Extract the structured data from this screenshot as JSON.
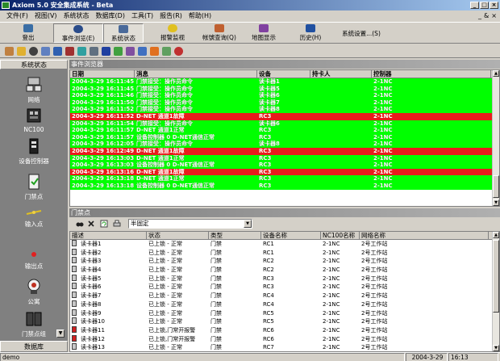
{
  "window": {
    "title": "Axiom 5.0 安全集成系统 - Beta"
  },
  "menu": [
    "文件(F)",
    "视图(V)",
    "系统状态",
    "数据库(D)",
    "工具(T)",
    "报告(R)",
    "帮助(H)"
  ],
  "menu_right": [
    "_",
    "&",
    "×"
  ],
  "toolbar": {
    "buttons": [
      {
        "label": "登出",
        "color": "#3a6ea5"
      },
      {
        "label": "事件浏览(E)",
        "color": "#2a4c8a"
      },
      {
        "label": "系统状态",
        "color": "#4a6a9a"
      },
      {
        "label": "报警监视",
        "color": "#e0c020"
      },
      {
        "label": "帐號查询(Q)",
        "color": "#c06030"
      },
      {
        "label": "地图显示",
        "color": "#8040a0"
      },
      {
        "label": "历史(H)",
        "color": "#2050a0"
      },
      {
        "label": "系统设置...(S)",
        "color": "#d4d0c8"
      }
    ]
  },
  "sidebar": {
    "title": "系统状态",
    "items": [
      {
        "label": "网络",
        "icon": "network-icon"
      },
      {
        "label": "NC100",
        "icon": "controller-icon"
      },
      {
        "label": "设备控制器",
        "icon": "device-controller-icon"
      },
      {
        "label": "门禁点",
        "icon": "door-point-icon"
      },
      {
        "label": "输入点",
        "icon": "input-point-icon"
      },
      {
        "label": "输出点",
        "icon": "output-point-icon"
      },
      {
        "label": "公寓",
        "icon": "apartment-icon"
      },
      {
        "label": "门禁点组",
        "icon": "door-group-icon"
      }
    ],
    "footer": "数据库"
  },
  "event_viewer": {
    "title": "事件浏览器",
    "columns": [
      "日期",
      "消息",
      "设备",
      "持卡人",
      "控制器"
    ],
    "rows": [
      {
        "date": "2004-3-29 16:11:45",
        "message": "门禁接受：操作员命令",
        "device": "读卡器1",
        "holder": "",
        "controller": "2-1NC",
        "status": "ok"
      },
      {
        "date": "2004-3-29 16:11:45",
        "message": "门禁接受：操作员命令",
        "device": "读卡器5",
        "holder": "",
        "controller": "2-1NC",
        "status": "ok"
      },
      {
        "date": "2004-3-29 16:11:46",
        "message": "门禁接受：操作员命令",
        "device": "读卡器6",
        "holder": "",
        "controller": "2-1NC",
        "status": "ok"
      },
      {
        "date": "2004-3-29 16:11:50",
        "message": "门禁接受：操作员命令",
        "device": "读卡器7",
        "holder": "",
        "controller": "2-1NC",
        "status": "ok"
      },
      {
        "date": "2004-3-29 16:11:52",
        "message": "门禁接受：操作员命令",
        "device": "读卡器8",
        "holder": "",
        "controller": "2-1NC",
        "status": "ok"
      },
      {
        "date": "2004-3-29 16:11:52",
        "message": "D-NET 通道1故障",
        "device": "RC3",
        "holder": "",
        "controller": "2-1NC",
        "status": "alarm"
      },
      {
        "date": "2004-3-29 16:11:54",
        "message": "门禁接受：操作员命令",
        "device": "读卡器6",
        "holder": "",
        "controller": "2-1NC",
        "status": "ok"
      },
      {
        "date": "2004-3-29 16:11:57",
        "message": "D-NET 通道1正常",
        "device": "RC3",
        "holder": "",
        "controller": "2-1NC",
        "status": "ok"
      },
      {
        "date": "2004-3-29 16:11:57",
        "message": "设备控制器 0 D-NET通信正常",
        "device": "RC3",
        "holder": "",
        "controller": "2-1NC",
        "status": "ok"
      },
      {
        "date": "2004-3-29 16:12:05",
        "message": "门禁接受：操作员命令",
        "device": "读卡器8",
        "holder": "",
        "controller": "2-1NC",
        "status": "ok"
      },
      {
        "date": "2004-3-29 16:12:49",
        "message": "D-NET 通道1故障",
        "device": "RC3",
        "holder": "",
        "controller": "2-1NC",
        "status": "alarm"
      },
      {
        "date": "2004-3-29 16:13:03",
        "message": "D-NET 通道1正常",
        "device": "RC3",
        "holder": "",
        "controller": "2-1NC",
        "status": "ok"
      },
      {
        "date": "2004-3-29 16:13:03",
        "message": "设备控制器 0 D-NET通信正常",
        "device": "RC3",
        "holder": "",
        "controller": "2-1NC",
        "status": "ok"
      },
      {
        "date": "2004-3-29 16:13:16",
        "message": "D-NET 通道1故障",
        "device": "RC3",
        "holder": "",
        "controller": "2-1NC",
        "status": "alarm"
      },
      {
        "date": "2004-3-29 16:13:18",
        "message": "D-NET 通道1正常",
        "device": "RC3",
        "holder": "",
        "controller": "2-1NC",
        "status": "ok"
      },
      {
        "date": "2004-3-29 16:13:18",
        "message": "设备控制器 0 D-NET通信正常",
        "device": "RC3",
        "holder": "",
        "controller": "2-1NC",
        "status": "ok"
      }
    ]
  },
  "door_panel": {
    "title": "门禁点",
    "filter_value": "半固定",
    "columns": [
      "描述",
      "状态",
      "类型",
      "设备名称",
      "NC100名称",
      "网络名称"
    ],
    "rows": [
      {
        "desc": "读卡器1",
        "status": "已上锁 - 正常",
        "type": "门禁",
        "device": "RC1",
        "nc": "2-1NC",
        "net": "2号工作站",
        "icon": "grey"
      },
      {
        "desc": "读卡器2",
        "status": "已上锁 - 正常",
        "type": "门禁",
        "device": "RC1",
        "nc": "2-1NC",
        "net": "2号工作站",
        "icon": "grey"
      },
      {
        "desc": "读卡器3",
        "status": "已上锁 - 正常",
        "type": "门禁",
        "device": "RC2",
        "nc": "2-1NC",
        "net": "2号工作站",
        "icon": "grey"
      },
      {
        "desc": "读卡器4",
        "status": "已上锁 - 正常",
        "type": "门禁",
        "device": "RC2",
        "nc": "2-1NC",
        "net": "2号工作站",
        "icon": "grey"
      },
      {
        "desc": "读卡器5",
        "status": "已上锁 - 正常",
        "type": "门禁",
        "device": "RC3",
        "nc": "2-1NC",
        "net": "2号工作站",
        "icon": "grey"
      },
      {
        "desc": "读卡器6",
        "status": "已上锁 - 正常",
        "type": "门禁",
        "device": "RC3",
        "nc": "2-1NC",
        "net": "2号工作站",
        "icon": "grey"
      },
      {
        "desc": "读卡器7",
        "status": "已上锁 - 正常",
        "type": "门禁",
        "device": "RC4",
        "nc": "2-1NC",
        "net": "2号工作站",
        "icon": "grey"
      },
      {
        "desc": "读卡器8",
        "status": "已上锁 - 正常",
        "type": "门禁",
        "device": "RC4",
        "nc": "2-1NC",
        "net": "2号工作站",
        "icon": "grey"
      },
      {
        "desc": "读卡器9",
        "status": "已上锁 - 正常",
        "type": "门禁",
        "device": "RC5",
        "nc": "2-1NC",
        "net": "2号工作站",
        "icon": "grey"
      },
      {
        "desc": "读卡器10",
        "status": "已上锁 - 正常",
        "type": "门禁",
        "device": "RC5",
        "nc": "2-1NC",
        "net": "2号工作站",
        "icon": "grey"
      },
      {
        "desc": "读卡器11",
        "status": "已上锁,门常开报警",
        "type": "门禁",
        "device": "RC6",
        "nc": "2-1NC",
        "net": "2号工作站",
        "icon": "red"
      },
      {
        "desc": "读卡器12",
        "status": "已上锁,门常开报警",
        "type": "门禁",
        "device": "RC6",
        "nc": "2-1NC",
        "net": "2号工作站",
        "icon": "red"
      },
      {
        "desc": "读卡器13",
        "status": "已上锁 - 正常",
        "type": "门禁",
        "device": "RC7",
        "nc": "2-1NC",
        "net": "2号工作站",
        "icon": "grey"
      }
    ]
  },
  "statusbar": {
    "user": "demo",
    "date": "2004-3-29",
    "time": "16:13"
  }
}
